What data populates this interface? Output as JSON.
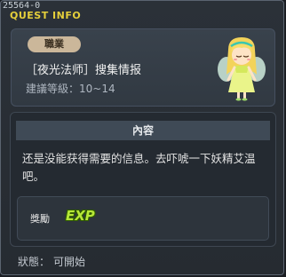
{
  "window": {
    "quest_id": "25564-0",
    "title": "QUEST INFO"
  },
  "header": {
    "job_badge": "職業",
    "quest_name": "［夜光法师］搜集情报",
    "level_label": "建議等級：",
    "level_range": "10~14"
  },
  "content": {
    "header": "內容",
    "text": "还是没能获得需要的信息。去吓唬一下妖精艾温吧。"
  },
  "reward": {
    "label": "獎勵",
    "exp_icon_text": "EXP"
  },
  "status": {
    "label": "狀態：",
    "value": "可開始"
  },
  "icons": {
    "npc": "fairy-girl-npc-icon",
    "exp": "exp-icon"
  },
  "colors": {
    "title": "#e5cf3b",
    "badge": "#cbb79a",
    "exp": "#b7e838"
  }
}
